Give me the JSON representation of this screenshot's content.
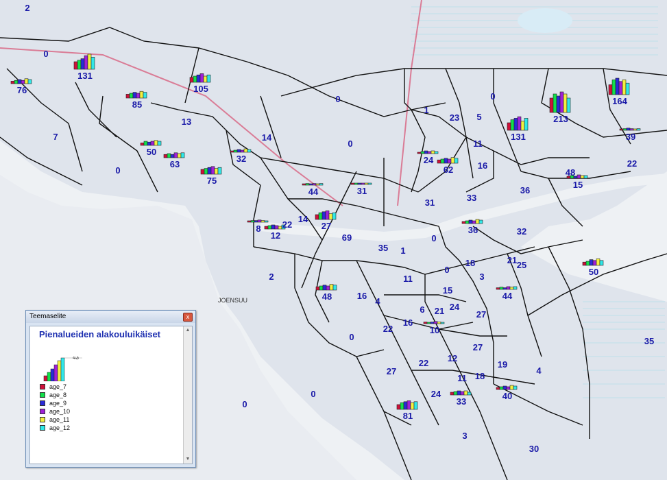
{
  "map": {
    "place_label": "JOENSUU",
    "district_values": [
      "2",
      "0",
      "131",
      "76",
      "105",
      "85",
      "7",
      "13",
      "50",
      "63",
      "14",
      "0",
      "75",
      "32",
      "0",
      "0",
      "1",
      "23",
      "5",
      "0",
      "131",
      "213",
      "164",
      "11",
      "24",
      "62",
      "16",
      "39",
      "22",
      "31",
      "33",
      "44",
      "36",
      "48",
      "15",
      "31",
      "22",
      "14",
      "8",
      "12",
      "27",
      "69",
      "35",
      "0",
      "36",
      "32",
      "1",
      "18",
      "21",
      "25",
      "2",
      "11",
      "0",
      "3",
      "15",
      "48",
      "16",
      "4",
      "6",
      "21",
      "24",
      "27",
      "44",
      "50",
      "16",
      "22",
      "0",
      "10",
      "27",
      "22",
      "12",
      "19",
      "27",
      "11",
      "18",
      "4",
      "24",
      "33",
      "40",
      "81",
      "35",
      "0",
      "0",
      "3",
      "30"
    ]
  },
  "legend_window": {
    "title": "Teemaselite",
    "close_glyph": "x",
    "heading": "Pienalueiden alakouluikäiset",
    "scale_value": "43",
    "items": [
      {
        "label": "age_7",
        "color": "#d0103a"
      },
      {
        "label": "age_8",
        "color": "#12e04a"
      },
      {
        "label": "age_9",
        "color": "#2a2ad8"
      },
      {
        "label": "age_10",
        "color": "#a020d8"
      },
      {
        "label": "age_11",
        "color": "#f4f040"
      },
      {
        "label": "age_12",
        "color": "#30e8e8"
      }
    ]
  },
  "colors": {
    "water": "#eef1f4",
    "land": "#dfe4ec",
    "boundary": "#111111",
    "road": "#d85a7a",
    "label": "#1a1aa8"
  }
}
